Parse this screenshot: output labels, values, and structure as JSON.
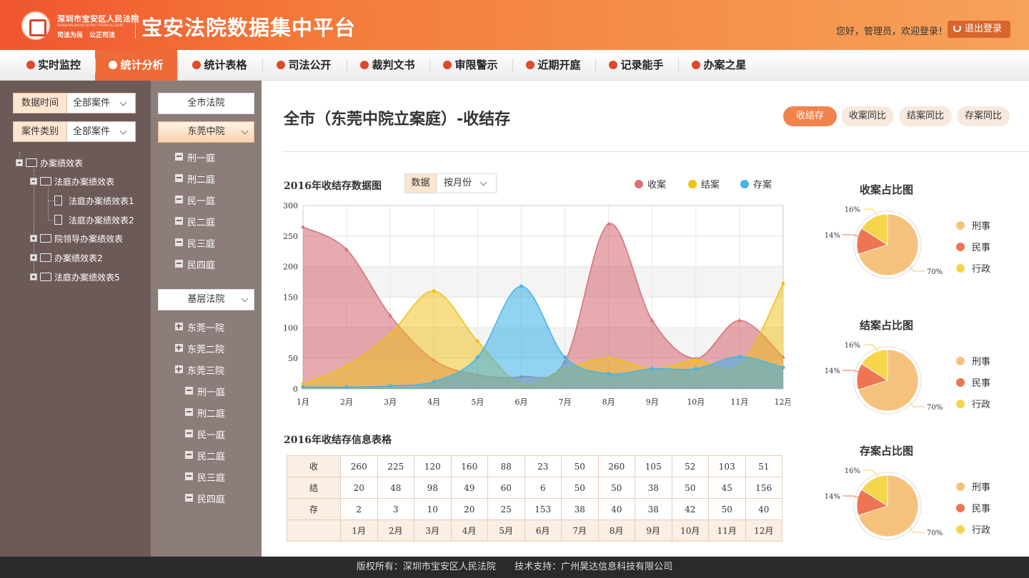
{
  "header": {
    "court_name": "深圳市宝安区人民法院",
    "court_en": "SHENZHEN BAOAN DISTRICT PEOPLE'S COURT",
    "motto": "司法为民　公正司法",
    "app_title": "宝安法院数据集中平台",
    "welcome": "您好，管理员，欢迎登录！",
    "logout": "退出登录"
  },
  "nav": [
    {
      "label": "实时监控"
    },
    {
      "label": "统计分析",
      "active": true
    },
    {
      "label": "统计表格"
    },
    {
      "label": "司法公开"
    },
    {
      "label": "裁判文书"
    },
    {
      "label": "审限警示"
    },
    {
      "label": "近期开庭"
    },
    {
      "label": "记录能手"
    },
    {
      "label": "办案之星"
    }
  ],
  "filters": [
    {
      "label": "数据时间",
      "value": "全部案件"
    },
    {
      "label": "案件类别",
      "value": "全部案件"
    }
  ],
  "tree": [
    {
      "label": "办案绩效表",
      "level": 0,
      "toggle": "minus",
      "icon": "folder"
    },
    {
      "label": "法庭办案绩效表",
      "level": 1,
      "toggle": "minus",
      "icon": "folder"
    },
    {
      "label": "法庭办案绩效表1",
      "level": 2,
      "toggle": "none",
      "icon": "file"
    },
    {
      "label": "法庭办案绩效表2",
      "level": 2,
      "toggle": "none",
      "icon": "file"
    },
    {
      "label": "院领导办案绩效表",
      "level": 1,
      "toggle": "plus",
      "icon": "folder"
    },
    {
      "label": "办案绩效表2",
      "level": 1,
      "toggle": "plus",
      "icon": "folder"
    },
    {
      "label": "法庭办案绩效表5",
      "level": 1,
      "toggle": "plus",
      "icon": "folder"
    }
  ],
  "courts": {
    "all_city": "全市法院",
    "dongguan_mid": "东莞中院",
    "mid_items": [
      "刑一庭",
      "刑二庭",
      "民一庭",
      "民二庭",
      "民三庭",
      "民四庭"
    ],
    "grassroots": "基层法院",
    "grass_items": [
      {
        "label": "东莞一院",
        "type": "plus",
        "indent": 0
      },
      {
        "label": "东莞二院",
        "type": "plus",
        "indent": 0
      },
      {
        "label": "东莞三院",
        "type": "plus",
        "indent": 0
      },
      {
        "label": "刑一庭",
        "type": "minus",
        "indent": 1
      },
      {
        "label": "刑二庭",
        "type": "minus",
        "indent": 1
      },
      {
        "label": "民一庭",
        "type": "minus",
        "indent": 1
      },
      {
        "label": "民二庭",
        "type": "minus",
        "indent": 1
      },
      {
        "label": "民三庭",
        "type": "minus",
        "indent": 1
      },
      {
        "label": "民四庭",
        "type": "minus",
        "indent": 1
      }
    ]
  },
  "main": {
    "title": "全市（东莞中院立案庭）-收结存",
    "tabs": [
      {
        "label": "收结存",
        "active": true
      },
      {
        "label": "收案同比"
      },
      {
        "label": "结案同比"
      },
      {
        "label": "存案同比"
      }
    ],
    "chart_title": "2016年收结存数据图",
    "data_filter": {
      "label": "数据",
      "value": "按月份"
    },
    "table_title": "2016年收结存信息表格"
  },
  "colors": {
    "shou": "#d9707a",
    "jie": "#f1c112",
    "cun": "#45b5e6",
    "xing": "#f5c27e",
    "min": "#ee7553",
    "xingzheng": "#f5d54a"
  },
  "chart_data": {
    "type": "area",
    "categories": [
      "1月",
      "2月",
      "3月",
      "4月",
      "5月",
      "6月",
      "7月",
      "8月",
      "9月",
      "10月",
      "11月",
      "12月"
    ],
    "series": [
      {
        "name": "收案",
        "values": [
          265,
          228,
          120,
          47,
          23,
          20,
          45,
          270,
          112,
          50,
          112,
          52
        ]
      },
      {
        "name": "结案",
        "values": [
          8,
          38,
          90,
          160,
          78,
          8,
          33,
          50,
          33,
          47,
          38,
          172
        ]
      },
      {
        "name": "存案",
        "values": [
          3,
          3,
          5,
          12,
          52,
          168,
          52,
          25,
          33,
          33,
          53,
          35
        ]
      }
    ],
    "yticks": [
      "0",
      "50",
      "100",
      "150",
      "200",
      "250",
      "300"
    ],
    "ylim": [
      0,
      300
    ],
    "grid": true,
    "legend": "top-right"
  },
  "table": {
    "rows": [
      {
        "label": "收",
        "values": [
          "260",
          "225",
          "120",
          "160",
          "88",
          "23",
          "50",
          "260",
          "105",
          "52",
          "103",
          "51"
        ]
      },
      {
        "label": "结",
        "values": [
          "20",
          "48",
          "98",
          "49",
          "60",
          "6",
          "50",
          "50",
          "38",
          "50",
          "45",
          "156"
        ]
      },
      {
        "label": "存",
        "values": [
          "2",
          "3",
          "10",
          "20",
          "25",
          "153",
          "38",
          "40",
          "38",
          "42",
          "50",
          "40"
        ]
      }
    ],
    "footer": [
      "",
      "1月",
      "2月",
      "3月",
      "4月",
      "5月",
      "6月",
      "7月",
      "8月",
      "9月",
      "10月",
      "11月",
      "12月"
    ]
  },
  "pies": [
    {
      "title": "收案占比图",
      "labels": [
        "刑事",
        "民事",
        "行政"
      ],
      "values": [
        70,
        14,
        16
      ],
      "pct": [
        "70%",
        "14%",
        "16%"
      ]
    },
    {
      "title": "结案占比图",
      "labels": [
        "刑事",
        "民事",
        "行政"
      ],
      "values": [
        70,
        14,
        16
      ],
      "pct": [
        "70%",
        "14%",
        "16%"
      ]
    },
    {
      "title": "存案占比图",
      "labels": [
        "刑事",
        "民事",
        "行政"
      ],
      "values": [
        70,
        14,
        16
      ],
      "pct": [
        "70%",
        "14%",
        "16%"
      ]
    }
  ],
  "footer": {
    "copyright": "版权所有：深圳市宝安区人民法院",
    "support": "技术支持：广州昊达信息科技有限公司"
  }
}
